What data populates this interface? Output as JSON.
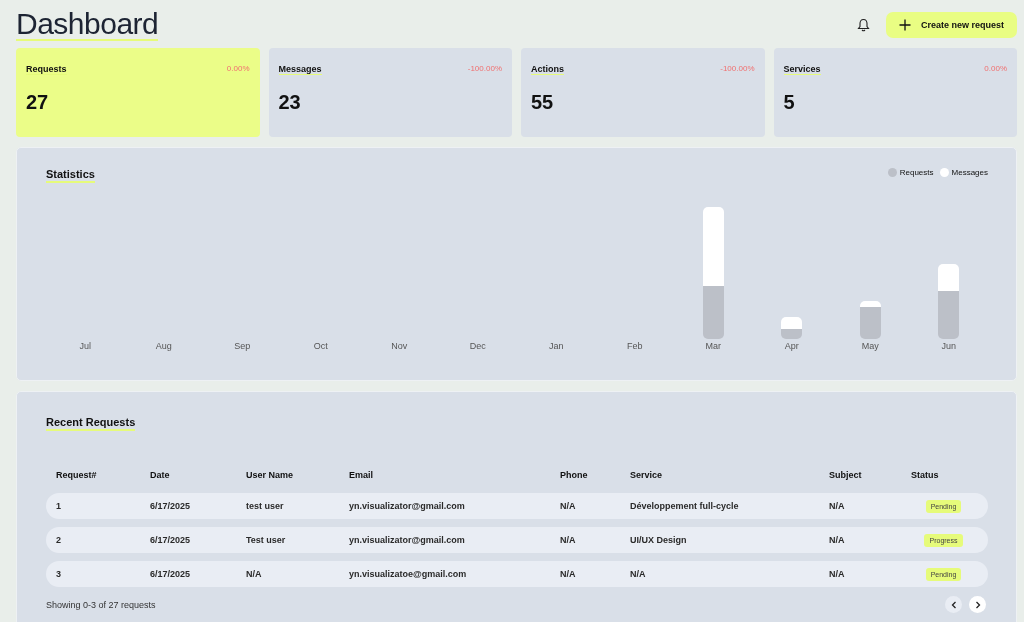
{
  "title": "Dashboard",
  "header": {
    "create_button": "Create new request"
  },
  "cards": [
    {
      "label": "Requests",
      "change": "0.00%",
      "value": "27",
      "selected": true
    },
    {
      "label": "Messages",
      "change": "-100.00%",
      "value": "23",
      "selected": false
    },
    {
      "label": "Actions",
      "change": "-100.00%",
      "value": "55",
      "selected": false
    },
    {
      "label": "Services",
      "change": "0.00%",
      "value": "5",
      "selected": false
    }
  ],
  "statistics": {
    "title": "Statistics",
    "legend": [
      {
        "label": "Requests",
        "color": "#bcc0c8"
      },
      {
        "label": "Messages",
        "color": "#ffffff"
      }
    ],
    "months": [
      "Jul",
      "Aug",
      "Sep",
      "Oct",
      "Nov",
      "Dec",
      "Jan",
      "Feb",
      "Mar",
      "Apr",
      "May",
      "Jun"
    ]
  },
  "recent_requests": {
    "title": "Recent Requests",
    "columns": [
      "Request#",
      "Date",
      "User Name",
      "Email",
      "Phone",
      "Service",
      "Subject",
      "Status"
    ],
    "rows": [
      [
        "1",
        "6/17/2025",
        "test user",
        "yn.visualizator@gmail.com",
        "N/A",
        "Développement full-cycle",
        "N/A",
        "Pending"
      ],
      [
        "2",
        "6/17/2025",
        "Test user",
        "yn.visualizator@gmail.com",
        "N/A",
        "UI/UX Design",
        "N/A",
        "Progress"
      ],
      [
        "3",
        "6/17/2025",
        "N/A",
        "yn.visualizatoe@gmail.com",
        "N/A",
        "N/A",
        "N/A",
        "Pending"
      ]
    ],
    "footer": "Showing 0-3 of 27 requests"
  }
}
